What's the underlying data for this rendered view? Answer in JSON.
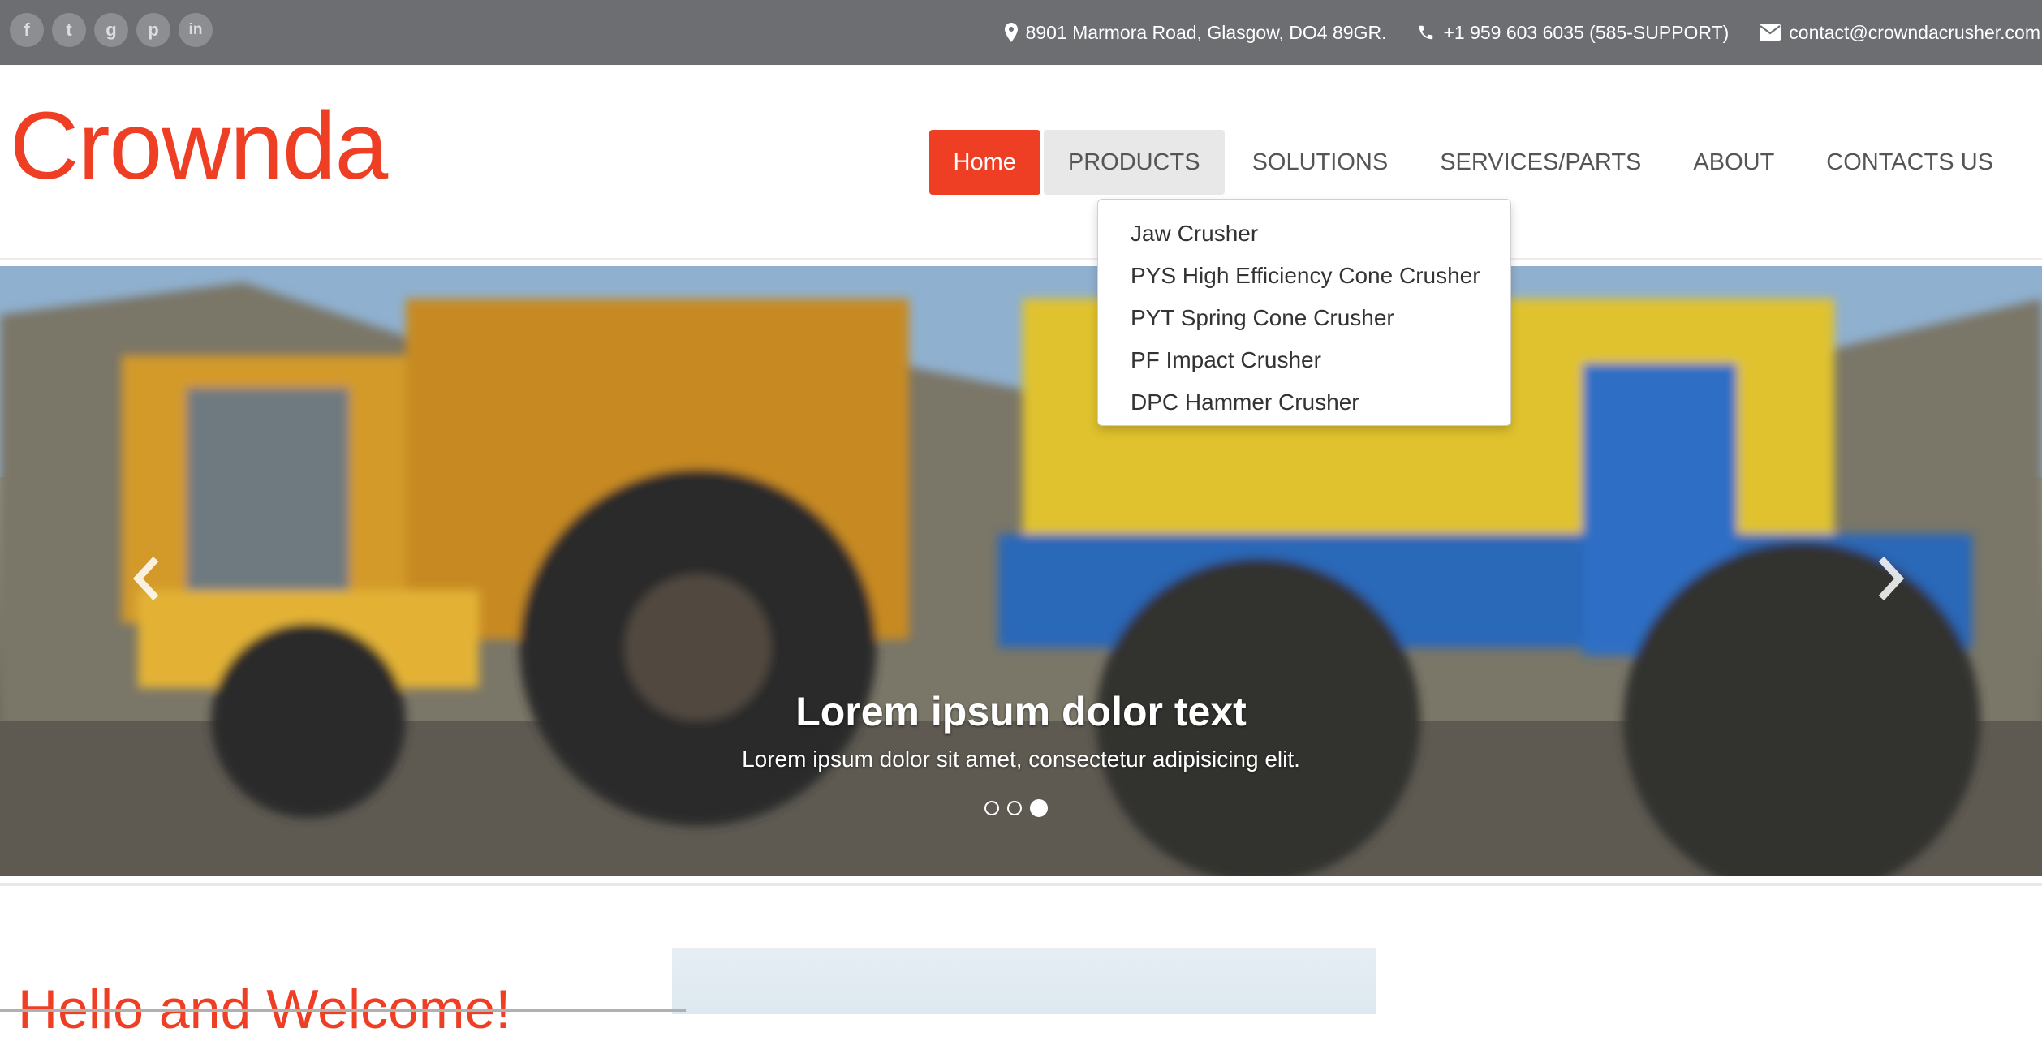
{
  "topbar": {
    "social": [
      {
        "icon": "facebook-icon",
        "glyph": "f"
      },
      {
        "icon": "twitter-icon",
        "glyph": "t"
      },
      {
        "icon": "google-plus-icon",
        "glyph": "g"
      },
      {
        "icon": "pinterest-icon",
        "glyph": "p"
      },
      {
        "icon": "linkedin-icon",
        "glyph": "in"
      }
    ],
    "address": "8901 Marmora Road, Glasgow, DO4 89GR.",
    "phone": "+1 959 603 6035 (585-SUPPORT)",
    "email": "contact@crowndacrusher.com"
  },
  "header": {
    "logo": "Crownda",
    "nav": [
      "Home",
      "PRODUCTS",
      "SOLUTIONS",
      "SERVICES/PARTS",
      "ABOUT",
      "CONTACTS US"
    ]
  },
  "dropdown": {
    "items": [
      "Jaw Crusher",
      "PYS High Efficiency Cone Crusher",
      "PYT Spring Cone Crusher",
      "PF Impact Crusher",
      "DPC Hammer Crusher"
    ]
  },
  "slider": {
    "title": "Lorem ipsum dolor text",
    "text": "Lorem ipsum dolor sit amet, consectetur adipisicing elit.",
    "slide_count": 3,
    "active_slide": 3
  },
  "welcome": {
    "heading": "Hello and Welcome!"
  },
  "colors": {
    "accent": "#ee3f24",
    "topbar": "#6d6e71"
  }
}
